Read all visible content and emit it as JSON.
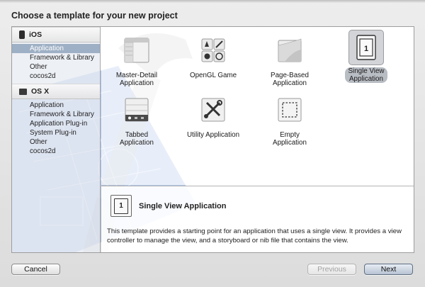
{
  "dialog": {
    "heading": "Choose a template for your new project"
  },
  "sidebar": {
    "groups": [
      {
        "title": "iOS",
        "icon": "iphone-icon",
        "items": [
          "Application",
          "Framework & Library",
          "Other",
          "cocos2d"
        ],
        "selected_index": 0
      },
      {
        "title": "OS X",
        "icon": "mac-icon",
        "items": [
          "Application",
          "Framework & Library",
          "Application Plug-in",
          "System Plug-in",
          "Other",
          "cocos2d"
        ],
        "selected_index": -1
      }
    ]
  },
  "templates": [
    {
      "label": "Master-Detail\nApplication",
      "icon": "master-detail-icon"
    },
    {
      "label": "OpenGL Game",
      "icon": "opengl-game-icon"
    },
    {
      "label": "Page-Based\nApplication",
      "icon": "page-based-icon"
    },
    {
      "label": "Single View\nApplication",
      "icon": "single-view-icon",
      "selected": true
    },
    {
      "label": "Tabbed Application",
      "icon": "tabbed-icon"
    },
    {
      "label": "Utility Application",
      "icon": "utility-icon"
    },
    {
      "label": "Empty Application",
      "icon": "empty-app-icon"
    }
  ],
  "detail": {
    "title": "Single View Application",
    "icon_glyph": "1",
    "description": "This template provides a starting point for an application that uses a single view. It provides a view controller to manage the view, and a storyboard or nib file that contains the view."
  },
  "buttons": {
    "cancel": "Cancel",
    "previous": "Previous",
    "next": "Next"
  },
  "colors": {
    "selection": "#9eb0c5",
    "blueprint": "#5a84d0"
  }
}
